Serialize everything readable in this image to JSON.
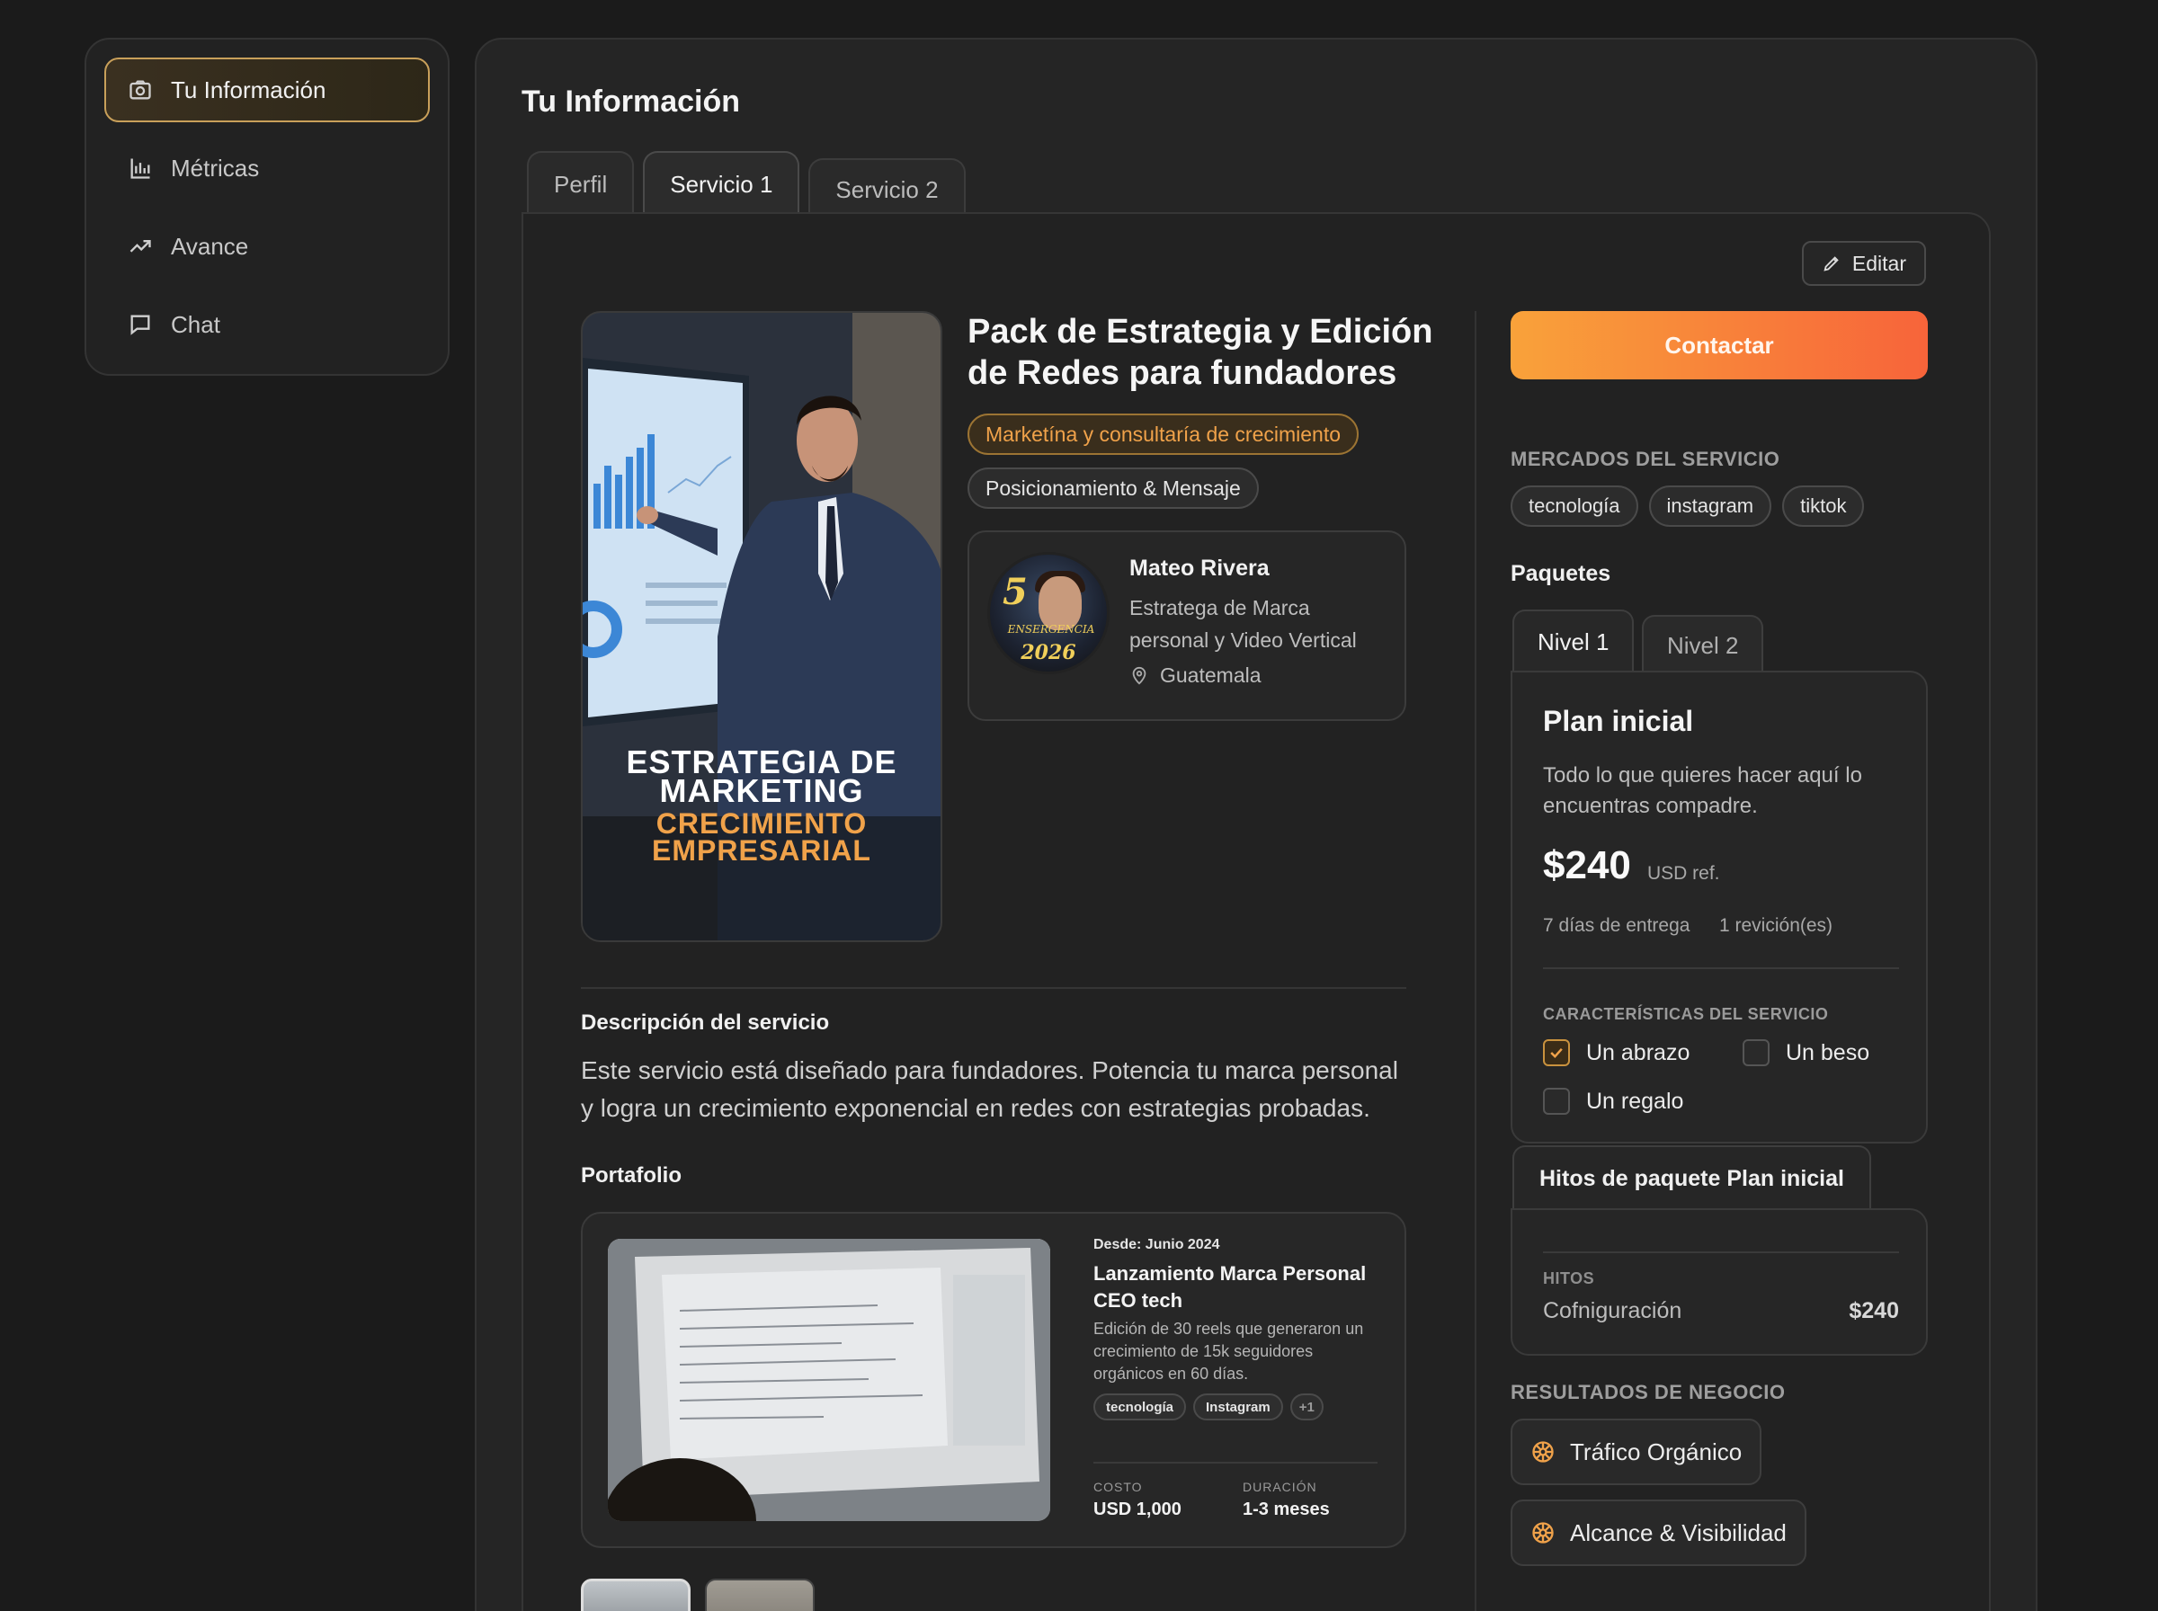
{
  "sidebar": {
    "items": [
      {
        "label": "Tu Información",
        "icon": "camera-icon",
        "active": true
      },
      {
        "label": "Métricas",
        "icon": "bar-chart-icon",
        "active": false
      },
      {
        "label": "Avance",
        "icon": "trend-up-icon",
        "active": false
      },
      {
        "label": "Chat",
        "icon": "chat-bubble-icon",
        "active": false
      }
    ]
  },
  "page": {
    "title": "Tu Información",
    "tabs": [
      {
        "label": "Perfil",
        "active": false
      },
      {
        "label": "Servicio 1",
        "active": true
      },
      {
        "label": "Servicio 2",
        "active": false
      }
    ],
    "edit_label": "Editar"
  },
  "service": {
    "hero": {
      "line1": "ESTRATEGIA DE",
      "line2": "MARKETING",
      "line3": "CRECIMIENTO",
      "line4": "EMPRESARIAL"
    },
    "title": "Pack de Estrategia y Edición de Redes para fundadores",
    "category": "Marketína y consultaría de crecimiento",
    "subcategory": "Posicionamiento & Mensaje",
    "provider": {
      "name": "Mateo Rivera",
      "role": "Estratega de Marca personal y Video Vertical",
      "location": "Guatemala",
      "avatar_year": "2026",
      "avatar_number": "5",
      "avatar_caption": "ENSERGENCIA"
    },
    "description_heading": "Descripción del servicio",
    "description": "Este servicio está diseñado para fundadores. Potencia tu marca personal y logra un crecimiento exponencial en redes con estrategias probadas.",
    "portfolio_heading": "Portafolio",
    "portfolio": {
      "date": "Desde: Junio 2024",
      "title": "Lanzamiento Marca Personal CEO tech",
      "desc": "Edición de 30 reels que generaron un crecimiento de 15k seguidores orgánicos en 60 días.",
      "tags": [
        "tecnología",
        "Instagram"
      ],
      "more": "+1",
      "cost_label": "COSTO",
      "cost": "USD 1,000",
      "duration_label": "DURACIÓN",
      "duration": "1-3 meses"
    }
  },
  "aside": {
    "contact_label": "Contactar",
    "markets_caption": "MERCADOS DEL SERVICIO",
    "markets": [
      "tecnología",
      "instagram",
      "tiktok"
    ],
    "packages_heading": "Paquetes",
    "package_tabs": [
      {
        "label": "Nivel 1",
        "active": true
      },
      {
        "label": "Nivel 2",
        "active": false
      }
    ],
    "plan": {
      "name": "Plan inicial",
      "desc": "Todo lo que quieres hacer aquí lo encuentras compadre.",
      "price": "$240",
      "price_ref": "USD ref.",
      "delivery": "7 días de entrega",
      "revisions": "1 revición(es)",
      "features_caption": "CARACTERÍSTICAS DEL SERVICIO",
      "features": [
        {
          "label": "Un abrazo",
          "checked": true
        },
        {
          "label": "Un beso",
          "checked": false
        },
        {
          "label": "Un regalo",
          "checked": false
        }
      ]
    },
    "milestones": {
      "tab_label": "Hitos de paquete Plan inicial",
      "caption": "HITOS",
      "item": "Cofniguración",
      "price": "$240"
    },
    "results_caption": "RESULTADOS DE NEGOCIO",
    "results": [
      "Tráfico Orgánico",
      "Alcance & Visibilidad"
    ],
    "accent_color": "#f0a24a"
  }
}
